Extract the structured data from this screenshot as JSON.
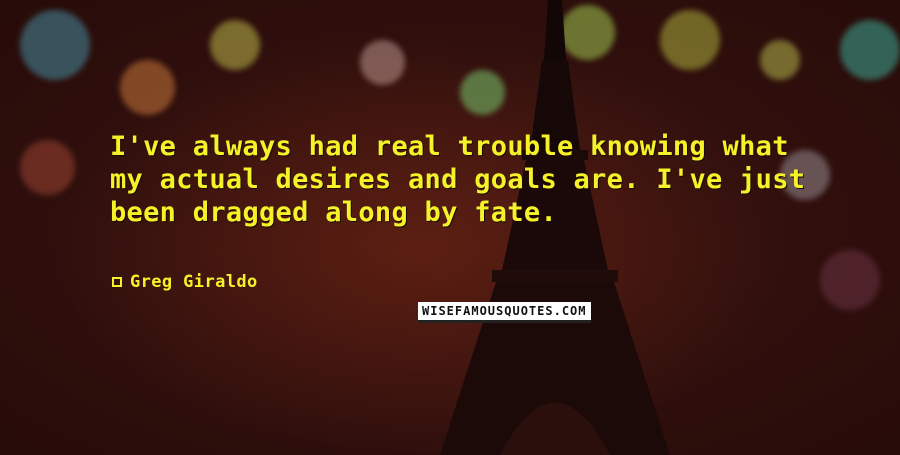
{
  "quote": {
    "text": "I've always had real trouble knowing what my actual desires and goals are. I've just been dragged along by fate.",
    "author": "Greg Giraldo"
  },
  "watermark": {
    "text": "WISEFAMOUSQUOTES.COM"
  },
  "colors": {
    "text": "#f5f22a",
    "background": "#2a0c0a"
  }
}
